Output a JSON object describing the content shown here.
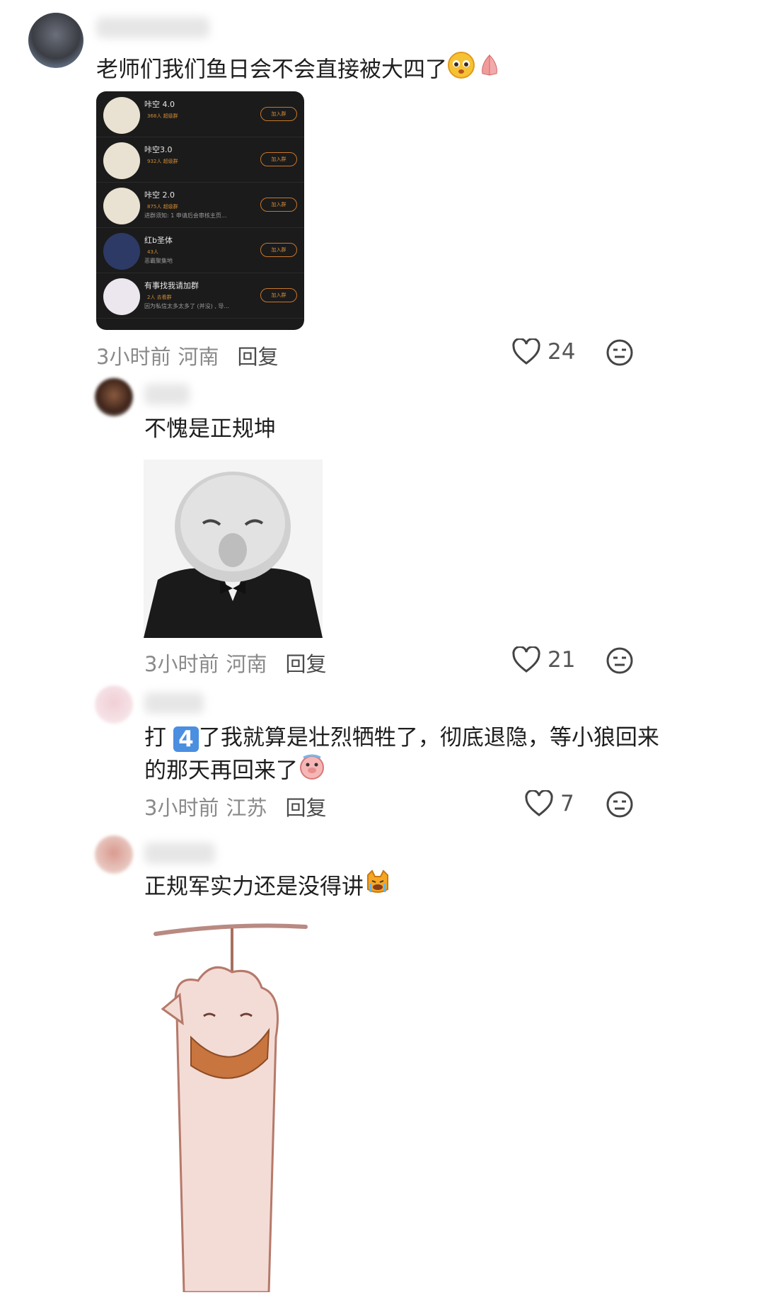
{
  "comments": [
    {
      "text": "老师们我们鱼日会不会直接被大四了",
      "time": "3小时前",
      "region": "河南",
      "reply": "回复",
      "likes": "24",
      "groups": [
        {
          "name": "咔空 4.0",
          "sub": "368人   超级群",
          "note": "",
          "button": "加入群"
        },
        {
          "name": "咔空3.0",
          "sub": "932人   超级群",
          "note": "",
          "button": "加入群"
        },
        {
          "name": "咔空 2.0",
          "sub": "875人   超级群",
          "note": "进群须知: 1 申请后会审核主页...",
          "button": "加入群"
        },
        {
          "name": "红b圣体",
          "sub": "43人",
          "note": "恶霸聚集地",
          "button": "加入群"
        },
        {
          "name": "有事找我请加群",
          "sub": "2人   去看群",
          "note": "因为私信太多太多了 (并没) , 导...",
          "button": "加入群"
        }
      ]
    },
    {
      "text": "不愧是正规坤",
      "time": "3小时前",
      "region": "河南",
      "reply": "回复",
      "likes": "21"
    },
    {
      "text_line1": "打",
      "keycap": "4",
      "text_line1b": "了我就算是壮烈牺牲了，彻底退隐，等小狼回来",
      "text_line2": "的那天再回来了",
      "time": "3小时前",
      "region": "江苏",
      "reply": "回复",
      "likes": "7"
    },
    {
      "text": "正规军实力还是没得讲"
    }
  ],
  "icons": [
    "heart-icon",
    "expressionless-face-icon"
  ],
  "colors": {
    "accent_orange": "#d48a3d",
    "card_bg": "#1b1b1b"
  }
}
